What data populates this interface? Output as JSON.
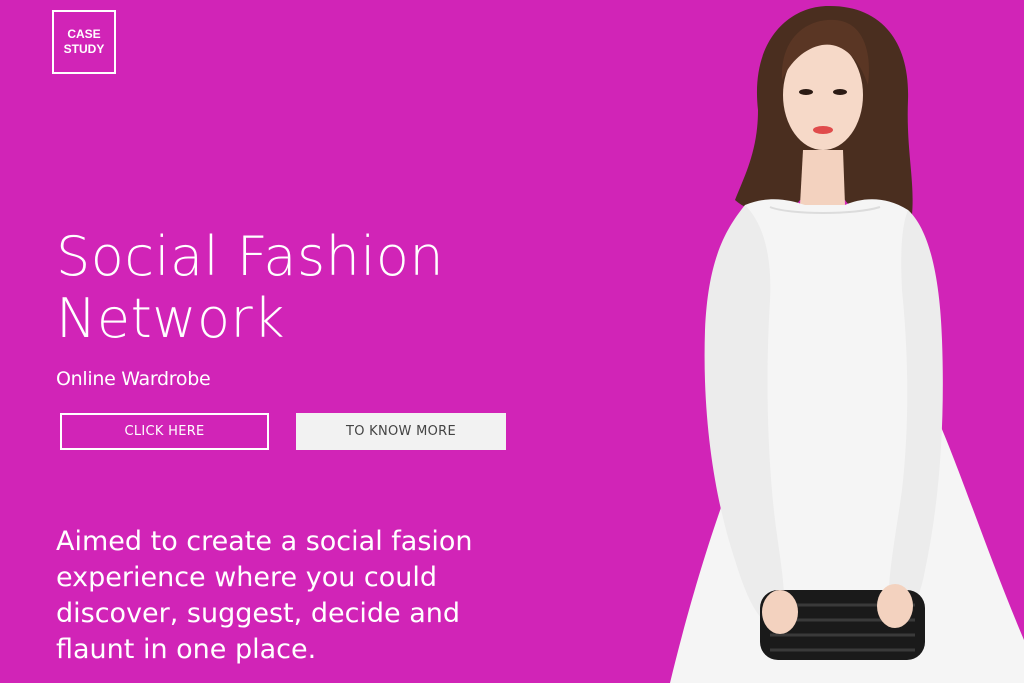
{
  "badge": {
    "line1": "CASE",
    "line2": "STUDY"
  },
  "hero": {
    "title_line1": "Social Fashion",
    "title_line2": "Network",
    "subtitle": "Online Wardrobe"
  },
  "buttons": {
    "primary_label": "CLICK HERE",
    "secondary_label": "TO KNOW MORE"
  },
  "description": {
    "line1": "Aimed to create a social fasion",
    "line2": "experience where you could",
    "line3": "discover, suggest, decide and",
    "line4": "flaunt in one place."
  },
  "colors": {
    "background": "#d124b7",
    "text": "#ffffff",
    "secondary_button_bg": "#f2f2f2",
    "secondary_button_text": "#444444"
  },
  "image": {
    "icon": "fashion-model-photo"
  }
}
